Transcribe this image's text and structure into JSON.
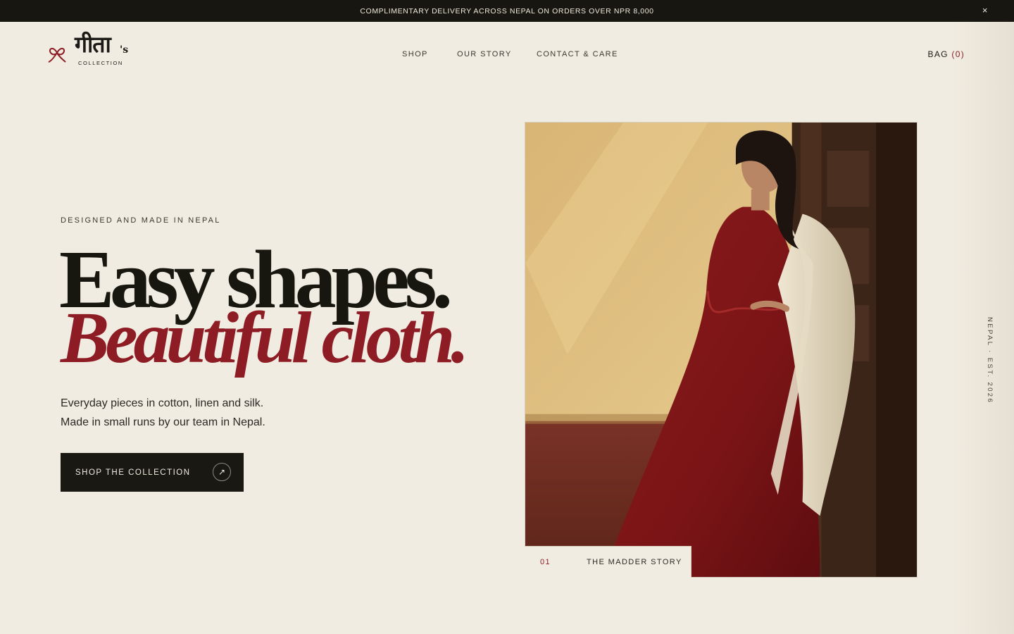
{
  "announcement": {
    "text": "COMPLIMENTARY DELIVERY ACROSS NEPAL ON ORDERS OVER NPR 8,000",
    "close_label": "×"
  },
  "brand": {
    "wordmark": "गीता",
    "possessive": "'s",
    "subtitle": "COLLECTION",
    "logo_icon": "flower-knot-icon"
  },
  "nav": {
    "items": [
      {
        "label": "SHOP"
      },
      {
        "label": "OUR STORY"
      },
      {
        "label": "CONTACT & CARE"
      }
    ],
    "bag_label": "BAG",
    "bag_count": "(0)"
  },
  "hero": {
    "eyebrow": "DESIGNED AND MADE IN NEPAL",
    "headline_1": "Easy shapes.",
    "headline_2": "Beautiful cloth.",
    "desc_line_1": "Everyday pieces in cotton, linen and silk.",
    "desc_line_2": "Made in small runs by our team in Nepal.",
    "cta_label": "SHOP THE COLLECTION",
    "cta_icon": "arrow-up-right-icon"
  },
  "feature": {
    "number": "01",
    "title": "THE MADDER STORY"
  },
  "side_text": "NEPAL · EST. 2026",
  "colors": {
    "background": "#f1ece1",
    "ink": "#17160f",
    "accent": "#8e1c25",
    "bar": "#171611"
  }
}
